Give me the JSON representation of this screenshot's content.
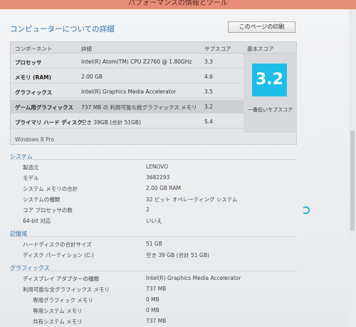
{
  "window": {
    "title": "パフォーマンスの情報とツール"
  },
  "header": {
    "title": "コンピューターについての詳細",
    "print_button": "このページの印刷"
  },
  "score_table": {
    "columns": [
      "コンポーネント",
      "詳細",
      "サブスコア",
      "基本スコア"
    ],
    "rows": [
      {
        "component": "プロセッサ",
        "detail": "Intel(R) Atom(TM) CPU Z2760 @ 1.80GHz",
        "subscore": "3.3"
      },
      {
        "component": "メモリ (RAM)",
        "detail": "2.00 GB",
        "subscore": "4.6"
      },
      {
        "component": "グラフィックス",
        "detail": "Intel(R) Graphics Media Accelerator",
        "subscore": "3.5"
      },
      {
        "component": "ゲーム用グラフィックス",
        "detail": "737 MB の 利用可能な総グラフィックス メモリ",
        "subscore": "3.2"
      },
      {
        "component": "プライマリ ハード ディスク",
        "detail": "空き 39GB (合計 51GB)",
        "subscore": "5.4"
      }
    ],
    "base_score": "3.2",
    "base_caption": "一番低いサブスコア",
    "os": "Windows 8 Pro"
  },
  "system": {
    "title": "システム",
    "rows": [
      {
        "label": "製造元",
        "value": "LENOVO"
      },
      {
        "label": "モデル",
        "value": "3682293"
      },
      {
        "label": "システム メモリの合計",
        "value": "2.00 GB RAM"
      },
      {
        "label": "システムの種類",
        "value": "32 ビット オペレーティング システム"
      },
      {
        "label": "コア プロセッサの数",
        "value": "2"
      },
      {
        "label": "64-bit 対応",
        "value": "いいえ"
      }
    ]
  },
  "storage": {
    "title": "記憶域",
    "rows": [
      {
        "label": "ハードディスクの合計サイズ",
        "value": "51 GB"
      },
      {
        "label": "ディスク パーティション (C:)",
        "value": "空き 39 GB (合計 51 GB)"
      }
    ]
  },
  "graphics": {
    "title": "グラフィックス",
    "rows": [
      {
        "label": "ディスプレイ アダプターの種類",
        "value": "Intel(R) Graphics Media Accelerator"
      },
      {
        "label": "利用可能な全グラフィックス メモリ",
        "value": "737 MB"
      },
      {
        "label": "専用グラフィック メモリ",
        "value": "0 MB"
      },
      {
        "label": "専用システム メモリ",
        "value": "0 MB"
      },
      {
        "label": "共有システム メモリ",
        "value": "737 MB"
      }
    ]
  },
  "colors": {
    "titlebar": "#e58d78",
    "accent": "#2d6fa8",
    "score_tile": "#1ebde7"
  }
}
